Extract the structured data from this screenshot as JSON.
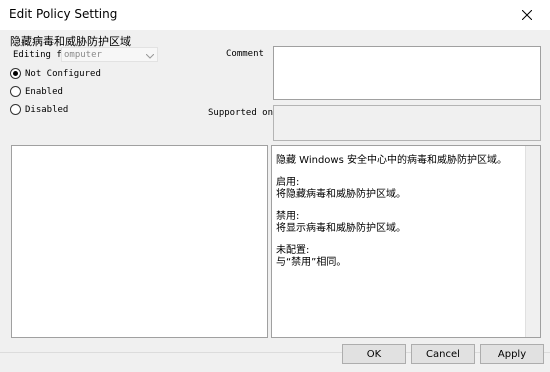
{
  "window": {
    "title": "Edit Policy Setting",
    "close_icon": "close-icon"
  },
  "policy": {
    "name": "隐藏病毒和威胁防护区域"
  },
  "editing": {
    "label": "Editing for",
    "value": "omputer"
  },
  "state": {
    "selected": "not_configured",
    "options": [
      {
        "id": "not_configured",
        "label": "Not Configured"
      },
      {
        "id": "enabled",
        "label": "Enabled"
      },
      {
        "id": "disabled",
        "label": "Disabled"
      }
    ]
  },
  "comment": {
    "label": "Comment",
    "value": ""
  },
  "supported_on": {
    "label": "Supported on",
    "value": ""
  },
  "help": {
    "paragraphs": [
      "隐藏 Windows 安全中心中的病毒和威胁防护区域。",
      "启用:\n将隐藏病毒和威胁防护区域。",
      "禁用:\n将显示病毒和威胁防护区域。",
      "未配置:\n与“禁用”相同。"
    ]
  },
  "buttons": {
    "ok": "OK",
    "cancel": "Cancel",
    "apply": "Apply"
  }
}
